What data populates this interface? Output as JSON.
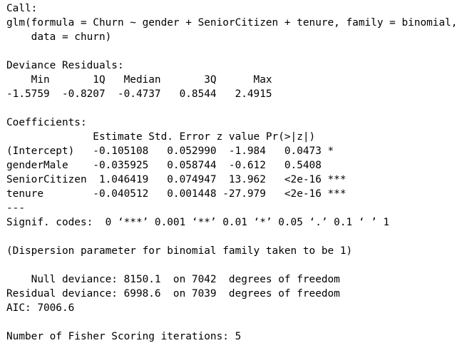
{
  "call": {
    "header": "Call:",
    "line1": "glm(formula = Churn ~ gender + SeniorCitizen + tenure, family = binomial,",
    "line2": "    data = churn)"
  },
  "deviance_residuals": {
    "header": "Deviance Residuals:",
    "labels_line": "    Min       1Q   Median       3Q      Max",
    "values_line": "-1.5759  -0.8207  -0.4737   0.8544   2.4915"
  },
  "coefficients": {
    "header": "Coefficients:",
    "columns_line": "              Estimate Std. Error z value Pr(>|z|)",
    "rows": [
      "(Intercept)   -0.105108   0.052990  -1.984   0.0473 *",
      "genderMale    -0.035925   0.058744  -0.612   0.5408",
      "SeniorCitizen  1.046419   0.074947  13.962   <2e-16 ***",
      "tenure        -0.040512   0.001448 -27.979   <2e-16 ***"
    ],
    "separator": "---",
    "signif_codes": "Signif. codes:  0 ‘***’ 0.001 ‘**’ 0.01 ‘*’ 0.05 ‘.’ 0.1 ‘ ’ 1"
  },
  "dispersion_note": "(Dispersion parameter for binomial family taken to be 1)",
  "deviance": {
    "null": "    Null deviance: 8150.1  on 7042  degrees of freedom",
    "residual": "Residual deviance: 6998.6  on 7039  degrees of freedom",
    "aic": "AIC: 7006.6"
  },
  "fisher_iterations": "Number of Fisher Scoring iterations: 5"
}
